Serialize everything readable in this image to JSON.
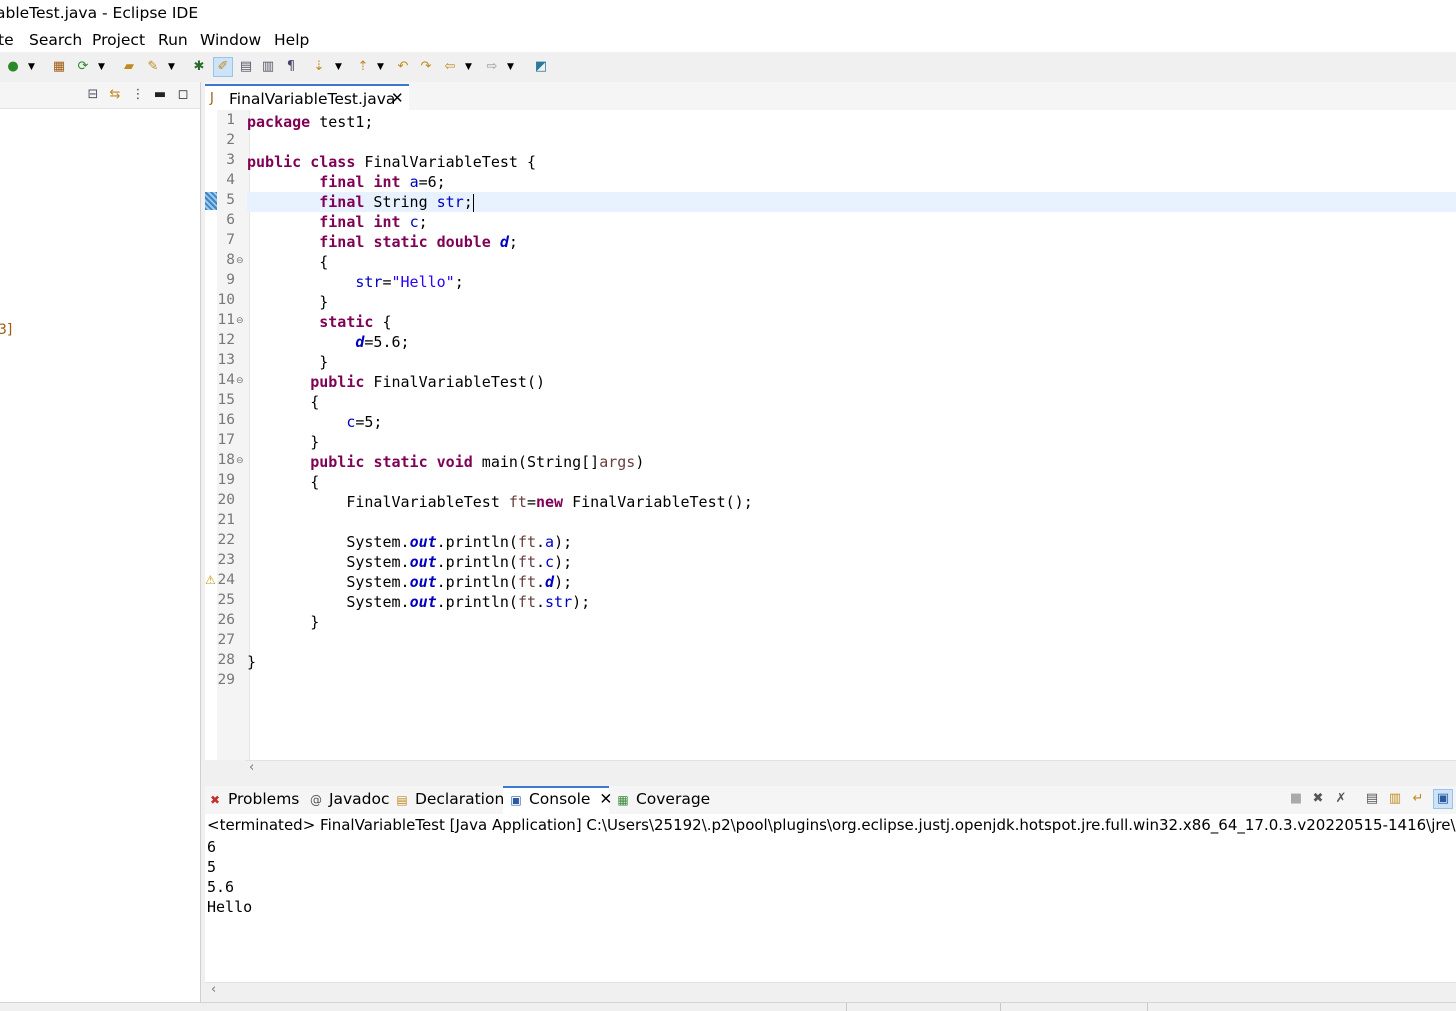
{
  "window": {
    "title": "ableTest.java - Eclipse IDE"
  },
  "menu": [
    "te",
    "Search",
    "Project",
    "Run",
    "Window",
    "Help"
  ],
  "left_panel": {
    "fragment": "3]"
  },
  "editor": {
    "tab_label": "FinalVariableTest.java",
    "line_numbers": [
      "1",
      "2",
      "3",
      "4",
      "5",
      "6",
      "7",
      "8",
      "9",
      "10",
      "11",
      "12",
      "13",
      "14",
      "15",
      "16",
      "17",
      "18",
      "19",
      "20",
      "21",
      "22",
      "23",
      "24",
      "25",
      "26",
      "27",
      "28",
      "29"
    ]
  },
  "bottom": {
    "tabs": [
      "Problems",
      "Javadoc",
      "Declaration",
      "Console",
      "Coverage"
    ],
    "console_header": "<terminated> FinalVariableTest [Java Application] C:\\Users\\25192\\.p2\\pool\\plugins\\org.eclipse.justj.openjdk.hotspot.jre.full.win32.x86_64_17.0.3.v20220515-1416\\jre\\bin\\ja",
    "output": [
      "6",
      "5",
      "5.6",
      "Hello"
    ]
  },
  "colors": {
    "keyword": "#7f0055",
    "field": "#0000c0",
    "string": "#2a00ff",
    "current_line": "#e8f2fe",
    "active_tab_border": "#3c78d0"
  }
}
